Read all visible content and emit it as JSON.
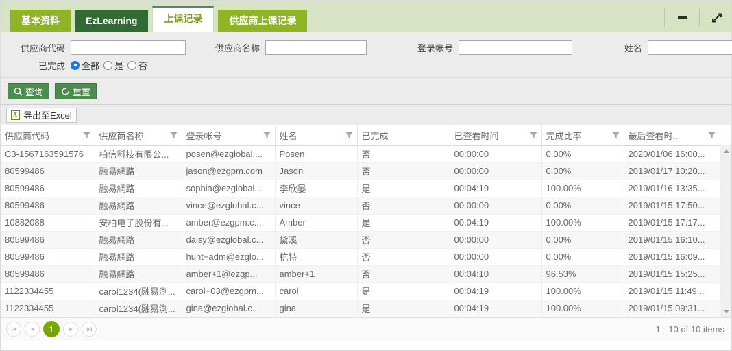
{
  "tabs": [
    {
      "label": "基本资料",
      "style": "green-light",
      "active": false
    },
    {
      "label": "EzLearning",
      "style": "green-dark",
      "active": false
    },
    {
      "label": "上课记录",
      "style": "active",
      "active": true
    },
    {
      "label": "供应商上课记录",
      "style": "green-light",
      "active": false
    }
  ],
  "window_controls": {
    "minimize": "minimize-icon",
    "expand": "expand-icon"
  },
  "filters": {
    "supplier_code": {
      "label": "供应商代码",
      "value": "",
      "placeholder": ""
    },
    "supplier_name": {
      "label": "供应商名称",
      "value": "",
      "placeholder": ""
    },
    "login_account": {
      "label": "登录帐号",
      "value": "",
      "placeholder": ""
    },
    "person_name": {
      "label": "姓名",
      "value": "",
      "placeholder": ""
    },
    "completed": {
      "label": "已完成",
      "options": [
        "全部",
        "是",
        "否"
      ],
      "selected": "全部"
    }
  },
  "buttons": {
    "search": "查询",
    "reset": "重置",
    "export_excel": "导出至Excel"
  },
  "grid": {
    "columns": [
      {
        "label": "供应商代码",
        "filterable": true
      },
      {
        "label": "供应商名称",
        "filterable": true
      },
      {
        "label": "登录帐号",
        "filterable": true
      },
      {
        "label": "姓名",
        "filterable": true
      },
      {
        "label": "已完成",
        "filterable": false
      },
      {
        "label": "已查看时间",
        "filterable": true
      },
      {
        "label": "完成比率",
        "filterable": true
      },
      {
        "label": "最后查看时...",
        "filterable": true
      }
    ],
    "rows": [
      [
        "C3-1567163591576",
        "柏信科技有限公...",
        "posen@ezglobal....",
        "Posen",
        "否",
        "00:00:00",
        "0.00%",
        "2020/01/06 16:00..."
      ],
      [
        "80599486",
        "融易網路",
        "jason@ezgpm.com",
        "Jason",
        "否",
        "00:00:00",
        "0.00%",
        "2019/01/17 10:20..."
      ],
      [
        "80599486",
        "融易網路",
        "sophia@ezglobal...",
        "李欣晏",
        "是",
        "00:04:19",
        "100.00%",
        "2019/01/16 13:35..."
      ],
      [
        "80599486",
        "融易網路",
        "vince@ezglobal.c...",
        "vince",
        "否",
        "00:00:00",
        "0.00%",
        "2019/01/15 17:50..."
      ],
      [
        "10882088",
        "安柏电子股份有...",
        "amber@ezgpm.c...",
        "Amber",
        "是",
        "00:04:19",
        "100.00%",
        "2019/01/15 17:17..."
      ],
      [
        "80599486",
        "融易網路",
        "daisy@ezglobal.c...",
        "黛溪",
        "否",
        "00:00:00",
        "0.00%",
        "2019/01/15 16:10..."
      ],
      [
        "80599486",
        "融易網路",
        "hunt+adm@ezglo...",
        "杭特",
        "否",
        "00:00:00",
        "0.00%",
        "2019/01/15 16:09..."
      ],
      [
        "80599486",
        "融易網路",
        "amber+1@ezgp...",
        "amber+1",
        "否",
        "00:04:10",
        "96.53%",
        "2019/01/15 15:25..."
      ],
      [
        "1122334455",
        "carol1234(融易測...",
        "carol+03@ezgpm...",
        "carol",
        "是",
        "00:04:19",
        "100.00%",
        "2019/01/15 11:49..."
      ],
      [
        "1122334455",
        "carol1234(融易測...",
        "gina@ezglobal.c...",
        "gina",
        "是",
        "00:04:19",
        "100.00%",
        "2019/01/15 09:31..."
      ]
    ]
  },
  "pager": {
    "first": "first-page-icon",
    "prev": "prev-page-icon",
    "current_page": "1",
    "next": "next-page-icon",
    "last": "last-page-icon",
    "info": "1 - 10 of 10 items"
  },
  "colors": {
    "tab_light": "#8fb526",
    "tab_dark": "#2f6b33",
    "tab_active_text": "#7a9c1e",
    "tab_active_border": "#4a7f96",
    "strip_bg": "#d7e3c2",
    "btn_green": "#4d8b4f",
    "pager_active": "#76a800",
    "radio_blue": "#1b7bec"
  }
}
